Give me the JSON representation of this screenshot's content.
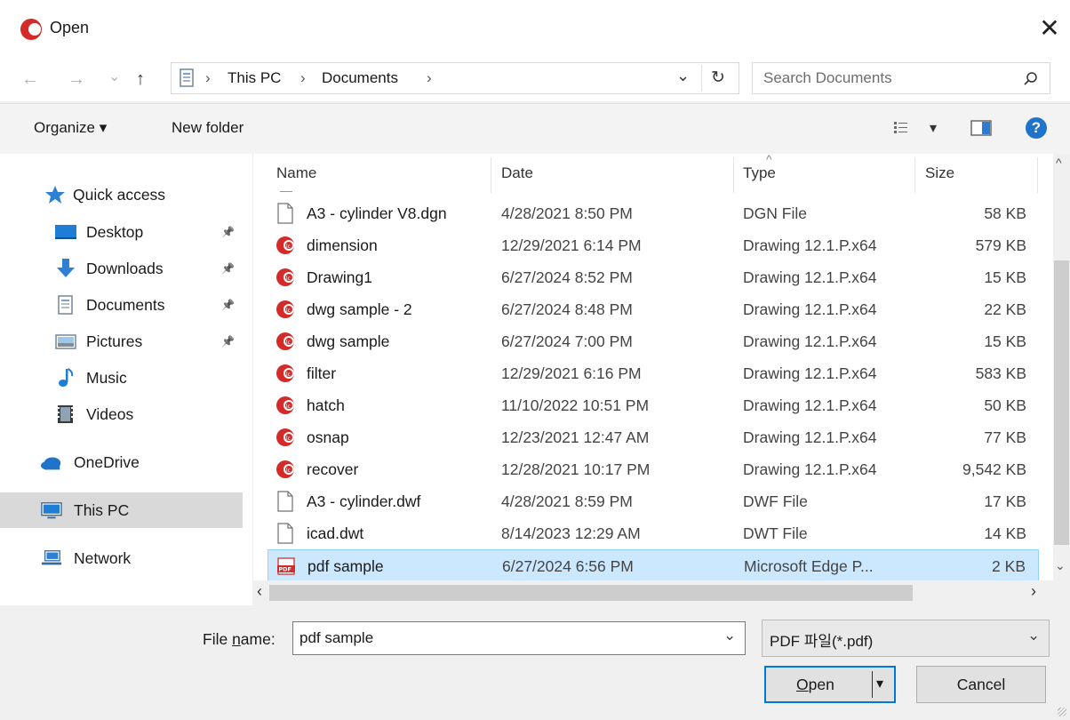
{
  "window": {
    "title": "Open",
    "close_glyph": "✕"
  },
  "nav": {
    "back_glyph": "←",
    "forward_glyph": "→",
    "recent_glyph": "⌄",
    "up_glyph": "↑",
    "breadcrumb": [
      "This PC",
      "Documents"
    ],
    "separator": "›",
    "dropdown_glyph": "⌄",
    "refresh_glyph": "↻",
    "search_placeholder": "Search Documents",
    "search_glyph": "⚲"
  },
  "toolbar": {
    "organize": "Organize ▾",
    "new_folder": "New folder",
    "view_arrow": "▾",
    "help": "?"
  },
  "sidebar": {
    "items": [
      {
        "label": "Quick access",
        "icon": "star-icon"
      },
      {
        "label": "Desktop",
        "icon": "desktop-icon",
        "pinned": true
      },
      {
        "label": "Downloads",
        "icon": "download-icon",
        "pinned": true
      },
      {
        "label": "Documents",
        "icon": "documents-icon",
        "pinned": true
      },
      {
        "label": "Pictures",
        "icon": "pictures-icon",
        "pinned": true
      },
      {
        "label": "Music",
        "icon": "music-icon"
      },
      {
        "label": "Videos",
        "icon": "videos-icon"
      },
      {
        "label": "OneDrive",
        "icon": "cloud-icon"
      },
      {
        "label": "This PC",
        "icon": "computer-icon",
        "selected": true
      },
      {
        "label": "Network",
        "icon": "network-icon"
      }
    ],
    "pin_glyph": "📌"
  },
  "columns": {
    "name": "Name",
    "date": "Date",
    "type": "Type",
    "size": "Size",
    "sort_glyph": "^"
  },
  "files": [
    {
      "name": "A3 - cylinder V8.dgn",
      "date": "4/28/2021 8:50 PM",
      "type": "DGN File",
      "size": "58 KB",
      "icon": "generic"
    },
    {
      "name": "dimension",
      "date": "12/29/2021 6:14 PM",
      "type": "Drawing 12.1.P.x64",
      "size": "579 KB",
      "icon": "cad"
    },
    {
      "name": "Drawing1",
      "date": "6/27/2024 8:52 PM",
      "type": "Drawing 12.1.P.x64",
      "size": "15 KB",
      "icon": "cad"
    },
    {
      "name": "dwg sample - 2",
      "date": "6/27/2024 8:48 PM",
      "type": "Drawing 12.1.P.x64",
      "size": "22 KB",
      "icon": "cad"
    },
    {
      "name": "dwg sample",
      "date": "6/27/2024 7:00 PM",
      "type": "Drawing 12.1.P.x64",
      "size": "15 KB",
      "icon": "cad"
    },
    {
      "name": "filter",
      "date": "12/29/2021 6:16 PM",
      "type": "Drawing 12.1.P.x64",
      "size": "583 KB",
      "icon": "cad"
    },
    {
      "name": "hatch",
      "date": "11/10/2022 10:51 PM",
      "type": "Drawing 12.1.P.x64",
      "size": "50 KB",
      "icon": "cad"
    },
    {
      "name": "osnap",
      "date": "12/23/2021 12:47 AM",
      "type": "Drawing 12.1.P.x64",
      "size": "77 KB",
      "icon": "cad"
    },
    {
      "name": "recover",
      "date": "12/28/2021 10:17 PM",
      "type": "Drawing 12.1.P.x64",
      "size": "9,542 KB",
      "icon": "cad"
    },
    {
      "name": "A3 - cylinder.dwf",
      "date": "4/28/2021 8:59 PM",
      "type": "DWF File",
      "size": "17 KB",
      "icon": "generic"
    },
    {
      "name": "icad.dwt",
      "date": "8/14/2023 12:29 AM",
      "type": "DWT File",
      "size": "14 KB",
      "icon": "generic"
    },
    {
      "name": "pdf sample",
      "date": "6/27/2024 6:56 PM",
      "type": "Microsoft Edge P...",
      "size": "2 KB",
      "icon": "pdf",
      "selected": true
    }
  ],
  "scroll": {
    "up": "^",
    "down": "⌄",
    "left": "‹",
    "right": "›"
  },
  "bottom": {
    "file_name_label_pre": "File ",
    "file_name_label_u": "n",
    "file_name_label_post": "ame:",
    "file_name_value": "pdf sample",
    "file_type_value": "PDF 파일(*.pdf)",
    "dropdown_glyph": "⌄",
    "open_u": "O",
    "open_rest": "pen",
    "split_arrow": "▾",
    "cancel": "Cancel"
  },
  "colors": {
    "accent": "#0078d7",
    "selection": "#cce8ff",
    "cad_red": "#d42a2a"
  }
}
